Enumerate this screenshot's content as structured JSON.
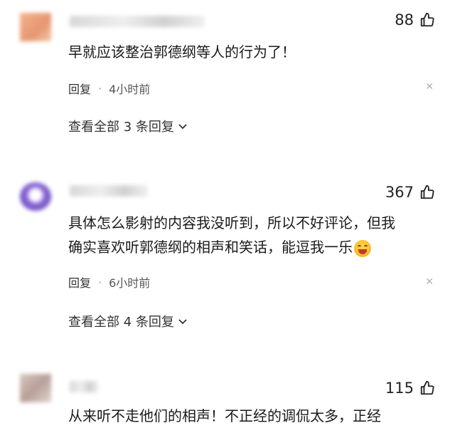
{
  "comments": [
    {
      "likes": "88",
      "text_lines": [
        "早就应该整治郭德纲等人的行为了！"
      ],
      "reply_label": "回复",
      "time": "4小时前",
      "view_replies": "查看全部 3 条回复",
      "avatar_color": "#f0a680"
    },
    {
      "likes": "367",
      "text_lines": [
        "具体怎么影射的内容我没听到，所以不好评论，但我",
        "确实喜欢听郭德纲的相声和笑话，能逗我一乐"
      ],
      "reply_label": "回复",
      "time": "6小时前",
      "view_replies": "查看全部 4 条回复",
      "avatar_color": "#7b5cc9"
    },
    {
      "likes": "115",
      "text_lines": [
        "从来听不走他们的相声！不正经的调侃太多，正经"
      ],
      "avatar_color": "#c9b8b0"
    }
  ],
  "icons": {
    "thumb": "thumbs-up-icon",
    "close": "close-icon",
    "chevron": "chevron-down-icon",
    "emoji": "laughing-emoji"
  }
}
